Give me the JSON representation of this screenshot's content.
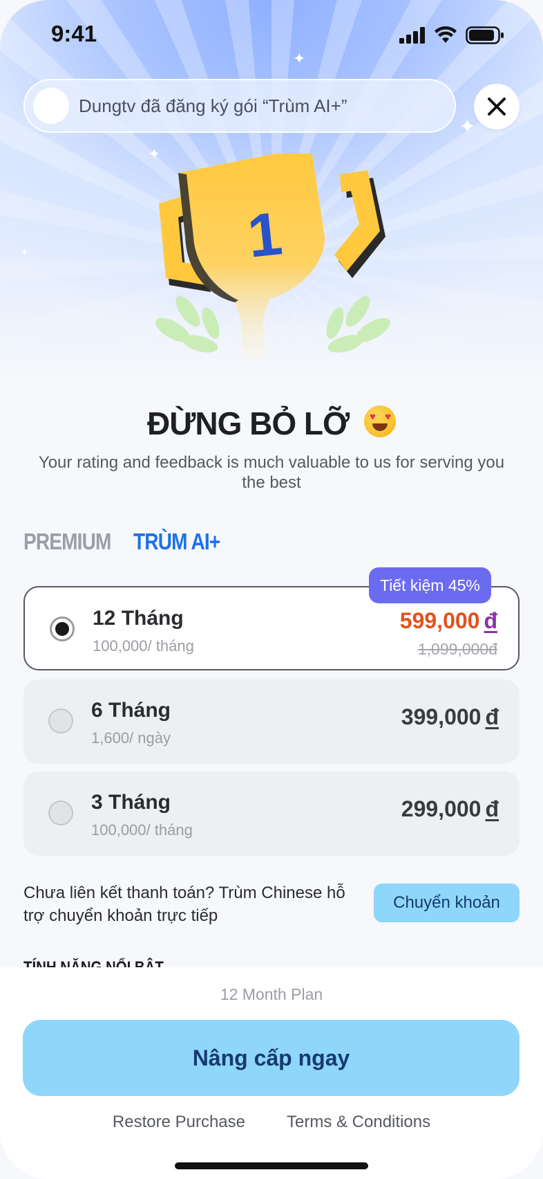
{
  "status_bar": {
    "time": "9:41"
  },
  "notification": {
    "text": "Dungtv đã đăng ký gói “Trùm AI+”"
  },
  "trophy": {
    "number": "1"
  },
  "headline": {
    "title": "ĐỪNG BỎ LỠ"
  },
  "subtitle": "Your rating and feedback  is much valuable to us for serving you the best",
  "plan_tabs": [
    {
      "label": "PREMIUM",
      "active": false
    },
    {
      "label": "TRÙM AI+",
      "active": true
    }
  ],
  "plans": [
    {
      "name": "12 Tháng",
      "sub": "100,000/ tháng",
      "price": "599,000",
      "currency": "đ",
      "old_price": "1,099,000đ",
      "badge": "Tiết kiệm 45%",
      "selected": true
    },
    {
      "name": "6 Tháng",
      "sub": "1,600/ ngày",
      "price": "399,000",
      "currency": "đ",
      "selected": false
    },
    {
      "name": "3 Tháng",
      "sub": "100,000/ tháng",
      "price": "299,000",
      "currency": "đ",
      "selected": false
    }
  ],
  "transfer": {
    "text": "Chưa liên kết thanh toán? Trùm Chinese hỗ trợ chuyển khoản trực tiếp",
    "button": "Chuyển khoản"
  },
  "features_heading": "TÍNH NĂNG NỔI BẬT",
  "bottom": {
    "plan_caption": "12 Month Plan",
    "cta": "Nâng cấp ngay",
    "restore": "Restore Purchase",
    "terms": "Terms & Conditions"
  },
  "colors": {
    "accent_blue": "#1b72e8",
    "cta_bg": "#8fd6fb",
    "badge_bg": "#6b6bf0",
    "price_highlight": "#e2521c"
  }
}
